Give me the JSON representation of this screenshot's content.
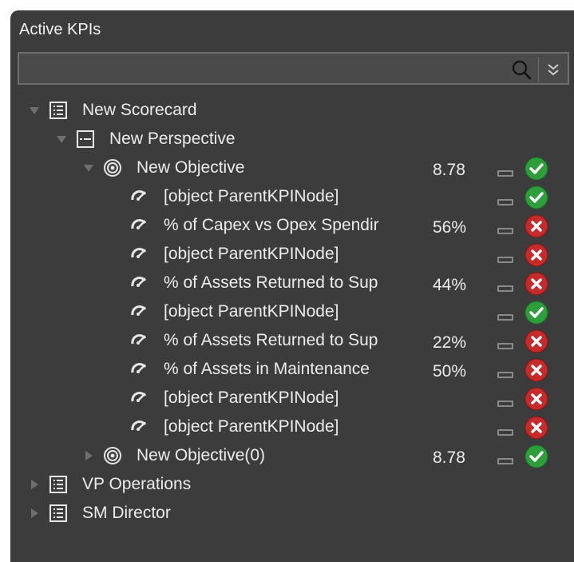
{
  "panel": {
    "title": "Active KPIs"
  },
  "search": {
    "value": "",
    "placeholder": "",
    "search_icon": "magnifier-icon",
    "expand_icon": "double-chevron-down-icon"
  },
  "tree": {
    "scorecard": {
      "label": "New Scorecard",
      "expanded": true,
      "icon": "list-icon"
    },
    "perspective": {
      "label": "New Perspective",
      "expanded": true,
      "icon": "perspective-icon"
    },
    "objective": {
      "label": "New Objective",
      "expanded": true,
      "icon": "target-icon",
      "value": "8.78",
      "trend": "flat",
      "status": "ok"
    },
    "kpis": [
      {
        "label": "[object ParentKPINode]",
        "value": "",
        "trend": "flat",
        "status": "ok"
      },
      {
        "label": "% of Capex vs Opex Spendir",
        "value": "56%",
        "trend": "flat",
        "status": "bad"
      },
      {
        "label": "[object ParentKPINode]",
        "value": "",
        "trend": "flat",
        "status": "bad"
      },
      {
        "label": "% of Assets Returned to Sup",
        "value": "44%",
        "trend": "flat",
        "status": "bad"
      },
      {
        "label": "[object ParentKPINode]",
        "value": "",
        "trend": "flat",
        "status": "ok"
      },
      {
        "label": "% of Assets Returned to Sup",
        "value": "22%",
        "trend": "flat",
        "status": "bad"
      },
      {
        "label": "% of Assets in Maintenance",
        "value": "50%",
        "trend": "flat",
        "status": "bad"
      },
      {
        "label": "[object ParentKPINode]",
        "value": "",
        "trend": "flat",
        "status": "bad"
      },
      {
        "label": "[object ParentKPINode]",
        "value": "",
        "trend": "flat",
        "status": "bad"
      }
    ],
    "objective2": {
      "label": "New Objective(0)",
      "expanded": false,
      "icon": "target-icon",
      "value": "8.78",
      "trend": "flat",
      "status": "ok"
    },
    "scorecards_collapsed": [
      {
        "label": "VP Operations",
        "expanded": false,
        "icon": "list-icon"
      },
      {
        "label": "SM Director",
        "expanded": false,
        "icon": "list-icon"
      }
    ]
  },
  "colors": {
    "panel_bg": "#3c3c3c",
    "text": "#ececec",
    "status_ok": "#2e9e3c",
    "status_bad": "#c62b2b",
    "caret": "#6e6e6e",
    "trend": "#8a8a8a"
  }
}
